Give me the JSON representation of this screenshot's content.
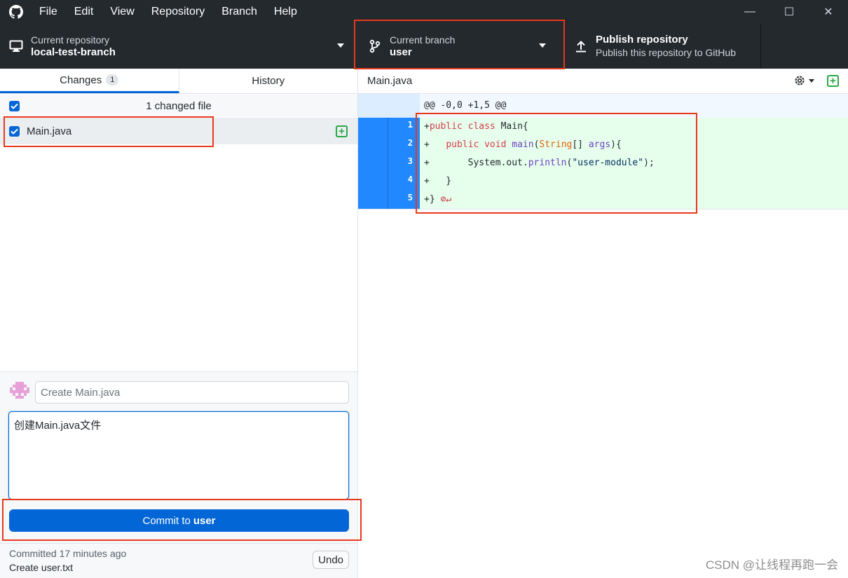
{
  "titlebar": {
    "menu": [
      "File",
      "Edit",
      "View",
      "Repository",
      "Branch",
      "Help"
    ],
    "minimize": "—",
    "maximize": "☐",
    "close": "✕"
  },
  "toolbar": {
    "repo_label": "Current repository",
    "repo_value": "local-test-branch",
    "branch_label": "Current branch",
    "branch_value": "user",
    "publish_title": "Publish repository",
    "publish_sub": "Publish this repository to GitHub"
  },
  "tabs": {
    "changes": "Changes",
    "changes_count": "1",
    "history": "History"
  },
  "changes": {
    "header": "1 changed file",
    "files": [
      {
        "name": "Main.java",
        "status": "added"
      }
    ]
  },
  "commit": {
    "summary_placeholder": "Create Main.java",
    "description": "创建Main.java文件",
    "button_prefix": "Commit to",
    "button_branch": "user",
    "last_time": "Committed 17 minutes ago",
    "last_message": "Create user.txt",
    "undo": "Undo"
  },
  "diff": {
    "file": "Main.java",
    "hunk": "@@ -0,0 +1,5 @@",
    "line_numbers": [
      "1",
      "2",
      "3",
      "4",
      "5"
    ]
  },
  "watermark": "CSDN @让线程再跑一会",
  "colors": {
    "accent": "#0366d6",
    "added_bg": "#e6ffed",
    "gutter_added": "#2188ff",
    "annotation": "#e8391b"
  }
}
